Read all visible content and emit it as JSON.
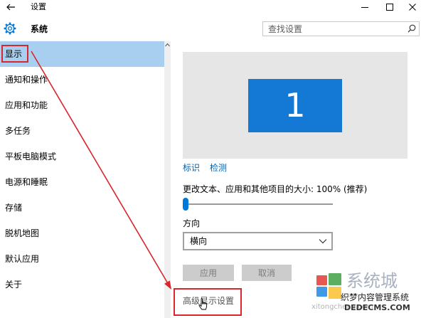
{
  "window": {
    "title": "设置",
    "back_icon": "back-arrow-icon",
    "minimize_icon": "minimize-icon",
    "maximize_icon": "maximize-icon",
    "close_icon": "close-icon"
  },
  "header": {
    "icon": "gear-icon",
    "title": "系统",
    "search": {
      "placeholder": "查找设置",
      "icon": "search-icon"
    }
  },
  "sidebar": {
    "items": [
      {
        "label": "显示",
        "selected": true
      },
      {
        "label": "通知和操作"
      },
      {
        "label": "应用和功能"
      },
      {
        "label": "多任务"
      },
      {
        "label": "平板电脑模式"
      },
      {
        "label": "电源和睡眠"
      },
      {
        "label": "存储"
      },
      {
        "label": "脱机地图"
      },
      {
        "label": "默认应用"
      },
      {
        "label": "关于"
      }
    ]
  },
  "display": {
    "monitor_label": "1",
    "links": {
      "identify": "标识",
      "detect": "检测"
    },
    "scale": {
      "label": "更改文本、应用和其他项目的大小: 100% (推荐)",
      "slider_level": 0
    },
    "orientation": {
      "label": "方向",
      "value": "横向"
    },
    "buttons": {
      "apply": "应用",
      "cancel": "取消",
      "disabled": true
    },
    "advanced_link": "高级显示设置"
  },
  "colors": {
    "accent": "#0078d7",
    "selected": "#a8cff0",
    "link": "#0063b1",
    "annotation": "#d9262c",
    "preview": "#e6e6e6",
    "monitor": "#1479d4"
  },
  "watermark": {
    "brand": "系统城",
    "url": "xitongcheng.com",
    "cms_name": "织梦内容管理系统",
    "cms_url": "DEDECMS.COM",
    "logo_colors": [
      "#e53935",
      "#43a047",
      "#1e88e5",
      "#fbc02d"
    ]
  }
}
